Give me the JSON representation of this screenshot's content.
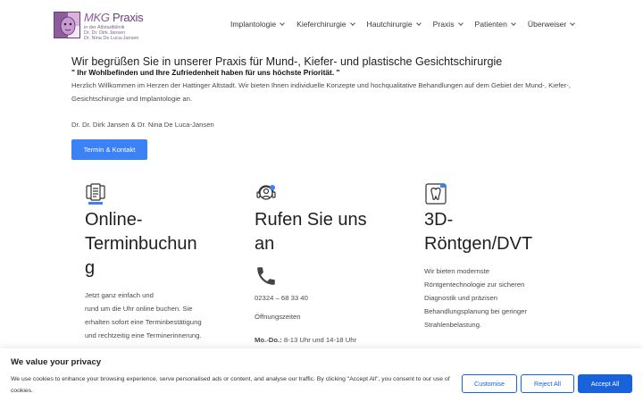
{
  "header": {
    "logo_title_1": "MKG",
    "logo_title_2": " Praxis",
    "logo_sub_1": "in der Altstadtklinik",
    "logo_sub_2": "Dr. Dr. Dirk Jansen",
    "logo_sub_3": "Dr. Nina De Luca-Jansen",
    "nav": [
      "Implantologie",
      "Kieferchirurgie",
      "Hautchirurgie",
      "Praxis",
      "Patienten",
      "Überweiser"
    ]
  },
  "hero": {
    "title": "Wir begrüßen Sie in unserer Praxis für Mund-, Kiefer- und plastische Gesichtschirurgie",
    "quote": "\" Ihr Wohlbefinden und Ihre Zufriedenheit haben für uns höchste Priorität. \"",
    "paragraph": "Herzlich Willkommen im Herzen der Hattinger Altstadt. Wir bieten Ihnen individuelle Konzepte und hochqualitative Behandlungen auf dem Gebiet der Mund-, Kiefer-, Gesichtschirurgie und Implantologie an.",
    "doctors": "Dr. Dr. Dirk Jansen & Dr. Nina De Luca-Jansen",
    "button": "Termin & Kontakt"
  },
  "columns": {
    "online": {
      "icon": "clipboard-checklist-icon",
      "title_1": "Online-",
      "title_2": "Terminbuchun",
      "title_3": "g",
      "text_1": "Jetzt ganz einfach und",
      "text_2": "rund um die Uhr online buchen. Sie",
      "text_3": "erhalten sofort eine Terminbestätigung",
      "text_4": "und rechtzeitig eine Terminerinnerung."
    },
    "call": {
      "icon": "headset-support-icon",
      "title_1": "Rufen Sie uns",
      "title_2": "an",
      "phone_icon": "phone-icon",
      "phone": "02324 – 68 33 40",
      "hours_label": "Öffnungszeiten",
      "hours_days": "Mo.-Do.:",
      "hours_time": " 8-13 Uhr und 14-18 Uhr"
    },
    "xray": {
      "icon": "tooth-3d-icon",
      "title_1": "3D-",
      "title_2": "Röntgen/DVT",
      "text_1": "Wir bieten modernste",
      "text_2": "Röntgentechnologie zur sicheren",
      "text_3": "Diagnostik und präzisen",
      "text_4": "Behandlungsplanung bei geringer",
      "text_5": "Strahlenbelastung."
    }
  },
  "cookie": {
    "title": "We value your privacy",
    "text": "We use cookies to enhance your browsing experience, serve personalised ads or content, and analyse our traffic. By clicking \"Accept All\", you consent to our use of cookies.",
    "customise": "Customise",
    "reject": "Reject All",
    "accept": "Accept All",
    "accent": "#1863dc"
  }
}
